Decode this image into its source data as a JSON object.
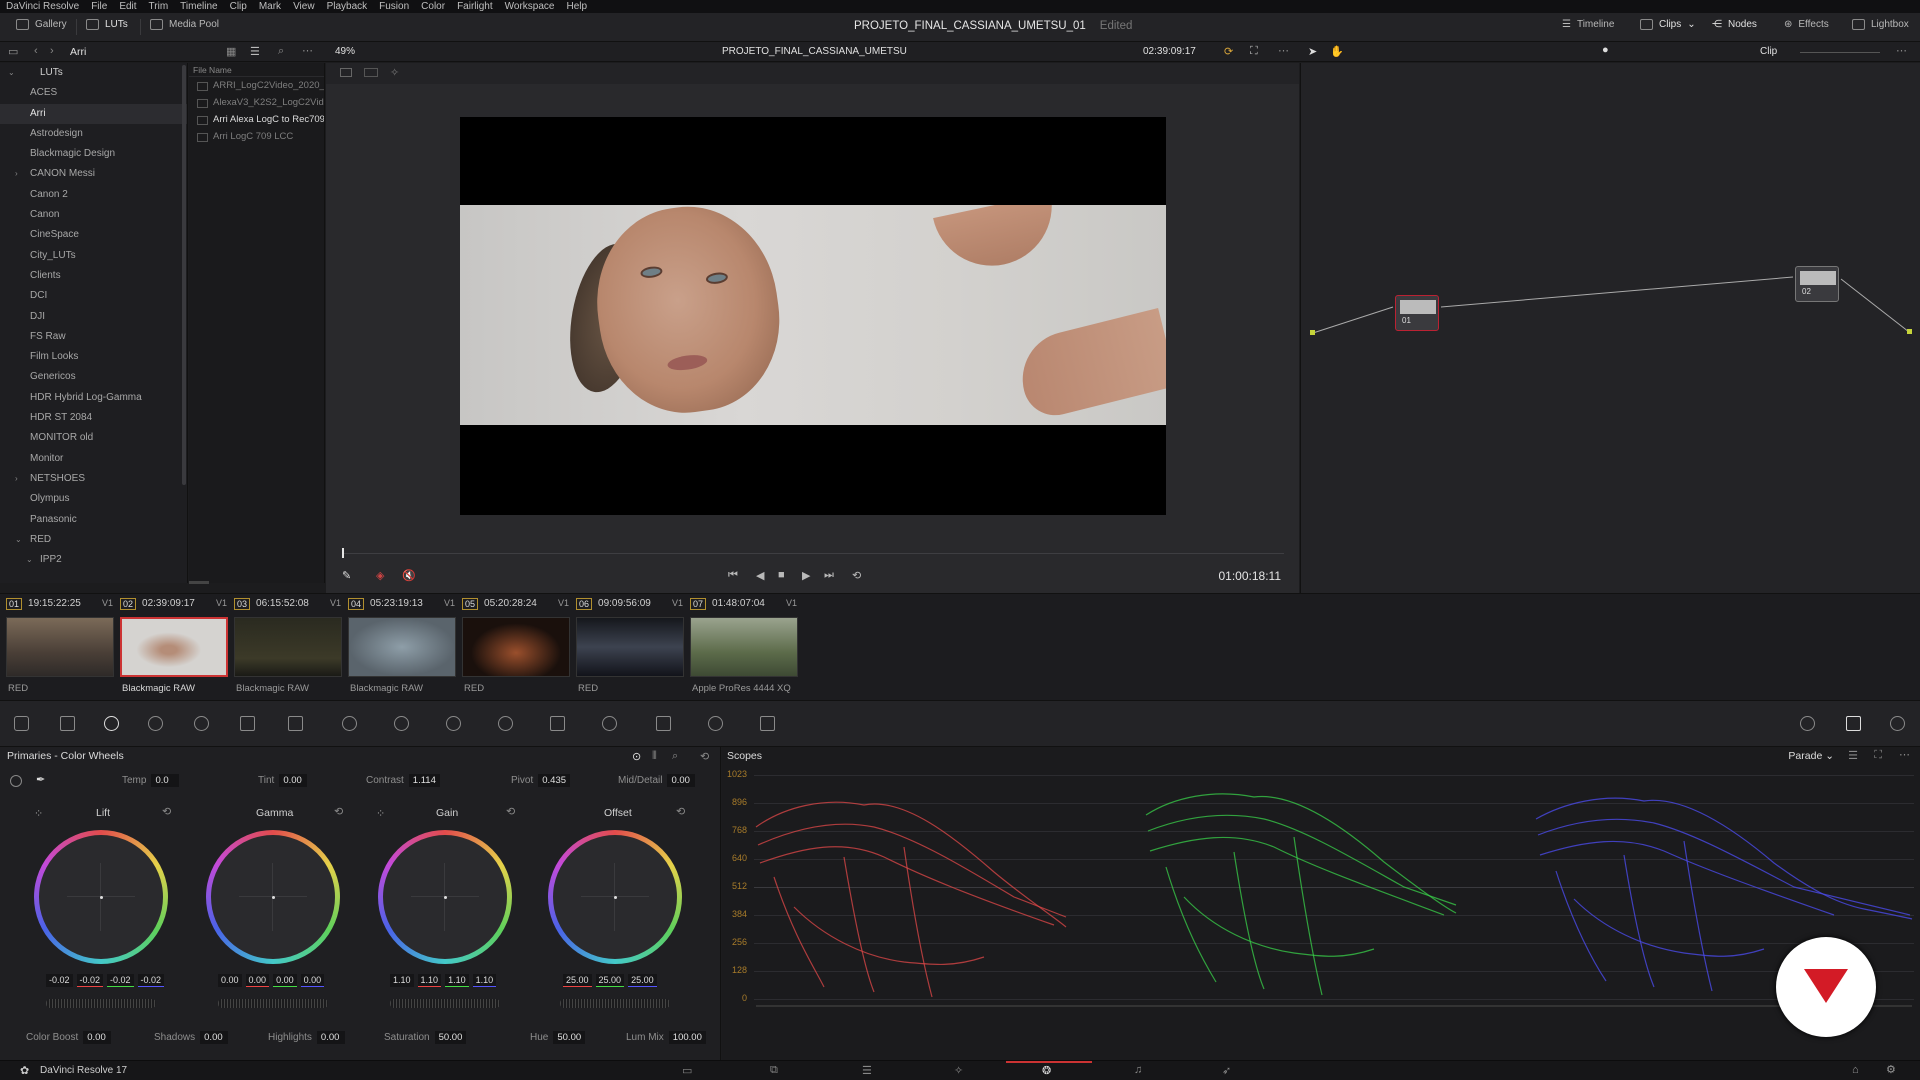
{
  "menubar": [
    "DaVinci Resolve",
    "File",
    "Edit",
    "Trim",
    "Timeline",
    "Clip",
    "Mark",
    "View",
    "Playback",
    "Fusion",
    "Color",
    "Fairlight",
    "Workspace",
    "Help"
  ],
  "topbar": {
    "gallery": "Gallery",
    "luts": "LUTs",
    "media_pool": "Media Pool",
    "project_title": "PROJETO_FINAL_CASSIANA_UMETSU_01",
    "edited": "Edited",
    "timeline": "Timeline",
    "clips": "Clips",
    "nodes": "Nodes",
    "effects": "Effects",
    "lightbox": "Lightbox"
  },
  "bar2": {
    "folder": "Arri",
    "zoom": "49%",
    "timeline_name": "PROJETO_FINAL_CASSIANA_UMETSU",
    "timecode": "02:39:09:17",
    "clip_mode": "Clip"
  },
  "lut_tree": {
    "root": "LUTs",
    "items": [
      "ACES",
      "Arri",
      "Astrodesign",
      "Blackmagic Design",
      "CANON Messi",
      "Canon 2",
      "Canon",
      "CineSpace",
      "City_LUTs",
      "Clients",
      "DCI",
      "DJI",
      "FS Raw",
      "Film Looks",
      "Genericos",
      "HDR Hybrid Log-Gamma",
      "HDR ST 2084",
      "MONITOR old",
      "Monitor",
      "NETSHOES",
      "Olympus",
      "Panasonic",
      "RED",
      "IPP2"
    ],
    "selected": "Arri"
  },
  "files": {
    "header": "File Name",
    "items": [
      "ARRI_LogC2Video_2020_",
      "AlexaV3_K2S2_LogC2Vide",
      "Arri Alexa LogC to Rec709",
      "Arri LogC 709 LCC"
    ]
  },
  "viewer": {
    "timecode": "01:00:18:11"
  },
  "nodes": {
    "node1": "01",
    "node2": "02"
  },
  "clips": [
    {
      "num": "01",
      "tc": "19:15:22:25",
      "track": "V1",
      "codec": "RED"
    },
    {
      "num": "02",
      "tc": "02:39:09:17",
      "track": "V1",
      "codec": "Blackmagic RAW"
    },
    {
      "num": "03",
      "tc": "06:15:52:08",
      "track": "V1",
      "codec": "Blackmagic RAW"
    },
    {
      "num": "04",
      "tc": "05:23:19:13",
      "track": "V1",
      "codec": "Blackmagic RAW"
    },
    {
      "num": "05",
      "tc": "05:20:28:24",
      "track": "V1",
      "codec": "RED"
    },
    {
      "num": "06",
      "tc": "09:09:56:09",
      "track": "V1",
      "codec": "RED"
    },
    {
      "num": "07",
      "tc": "01:48:07:04",
      "track": "V1",
      "codec": "Apple ProRes 4444 XQ"
    }
  ],
  "primaries": {
    "title": "Primaries - Color Wheels",
    "temp_label": "Temp",
    "temp": "0.0",
    "tint_label": "Tint",
    "tint": "0.00",
    "contrast_label": "Contrast",
    "contrast": "1.114",
    "pivot_label": "Pivot",
    "pivot": "0.435",
    "middetail_label": "Mid/Detail",
    "middetail": "0.00",
    "wheels": [
      {
        "name": "Lift",
        "values": [
          "-0.02",
          "-0.02",
          "-0.02",
          "-0.02"
        ]
      },
      {
        "name": "Gamma",
        "values": [
          "0.00",
          "0.00",
          "0.00",
          "0.00"
        ]
      },
      {
        "name": "Gain",
        "values": [
          "1.10",
          "1.10",
          "1.10",
          "1.10"
        ]
      },
      {
        "name": "Offset",
        "values": [
          "25.00",
          "25.00",
          "25.00"
        ]
      }
    ],
    "color_boost_label": "Color Boost",
    "color_boost": "0.00",
    "shadows_label": "Shadows",
    "shadows": "0.00",
    "highlights_label": "Highlights",
    "highlights": "0.00",
    "saturation_label": "Saturation",
    "saturation": "50.00",
    "hue_label": "Hue",
    "hue": "50.00",
    "lum_mix_label": "Lum Mix",
    "lum_mix": "100.00"
  },
  "scopes": {
    "title": "Scopes",
    "mode": "Parade",
    "y_labels": [
      "1023",
      "896",
      "768",
      "640",
      "512",
      "384",
      "256",
      "128",
      "0"
    ],
    "colors": {
      "red": "#e04848",
      "green": "#39d04a",
      "blue": "#4a4ae6"
    }
  },
  "statusbar": {
    "app": "DaVinci Resolve 17"
  }
}
